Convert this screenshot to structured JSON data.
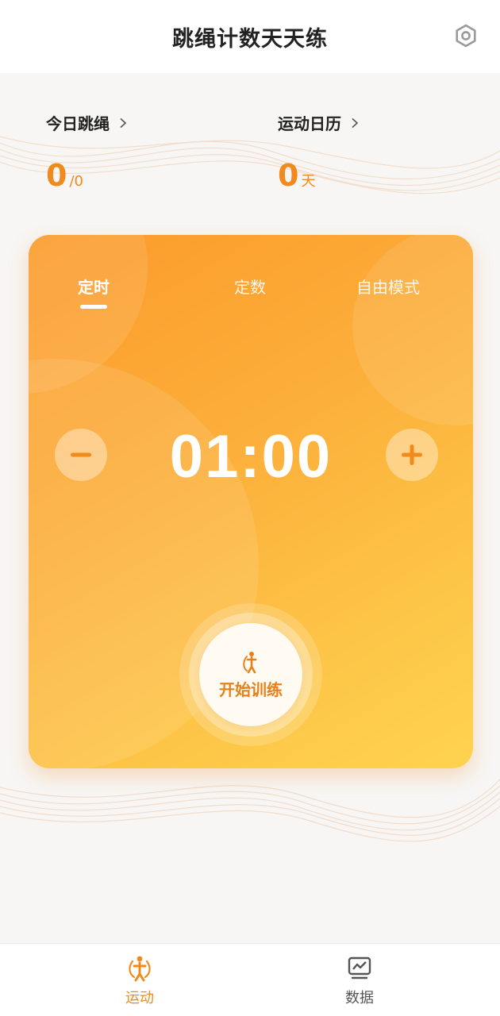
{
  "header": {
    "title": "跳绳计数天天练",
    "settings_icon": "settings-hex-icon"
  },
  "stats": {
    "today": {
      "label": "今日跳绳",
      "value": "0",
      "suffix": "/0"
    },
    "calendar": {
      "label": "运动日历",
      "value": "0",
      "suffix": "天"
    }
  },
  "card": {
    "tabs": [
      {
        "label": "定时",
        "active": true
      },
      {
        "label": "定数",
        "active": false
      },
      {
        "label": "自由模式",
        "active": false
      }
    ],
    "time": "01:00",
    "start_label": "开始训练"
  },
  "bottom_nav": {
    "items": [
      {
        "label": "运动",
        "icon": "jump-rope-icon",
        "active": true
      },
      {
        "label": "数据",
        "icon": "chart-icon",
        "active": false
      }
    ]
  },
  "colors": {
    "accent": "#f08a1c",
    "card_gradient_start": "#fb9a2b",
    "card_gradient_end": "#fed34f"
  }
}
